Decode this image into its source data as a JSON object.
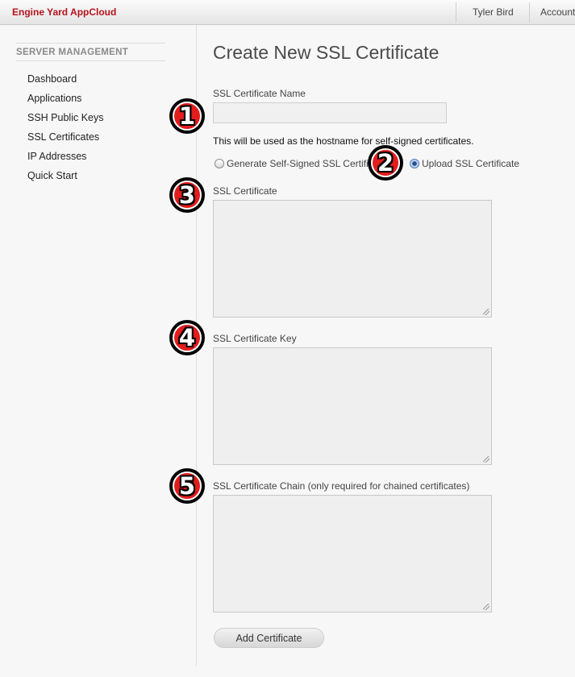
{
  "topbar": {
    "brand": "Engine Yard AppCloud",
    "user_name": "Tyler Bird",
    "account_label": "Account"
  },
  "sidebar": {
    "heading": "SERVER MANAGEMENT",
    "items": [
      {
        "label": "Dashboard"
      },
      {
        "label": "Applications"
      },
      {
        "label": "SSH Public Keys"
      },
      {
        "label": "SSL Certificates"
      },
      {
        "label": "IP Addresses"
      },
      {
        "label": "Quick Start"
      }
    ]
  },
  "form": {
    "title": "Create New SSL Certificate",
    "name_label": "SSL Certificate Name",
    "name_value": "",
    "hint": "This will be used as the hostname for self-signed certificates.",
    "radio_generate": "Generate Self-Signed SSL Certificate",
    "radio_upload": "Upload SSL Certificate",
    "selected_radio": "upload",
    "certificate_label": "SSL Certificate",
    "certificate_value": "",
    "key_label": "SSL Certificate Key",
    "key_value": "",
    "chain_label": "SSL Certificate Chain (only required for chained certificates)",
    "chain_value": "",
    "submit_label": "Add Certificate"
  },
  "markers": [
    "1",
    "2",
    "3",
    "4",
    "5"
  ],
  "colors": {
    "brand": "#b5121b",
    "marker_fill": "#e31c1c",
    "marker_outline": "#000000"
  }
}
